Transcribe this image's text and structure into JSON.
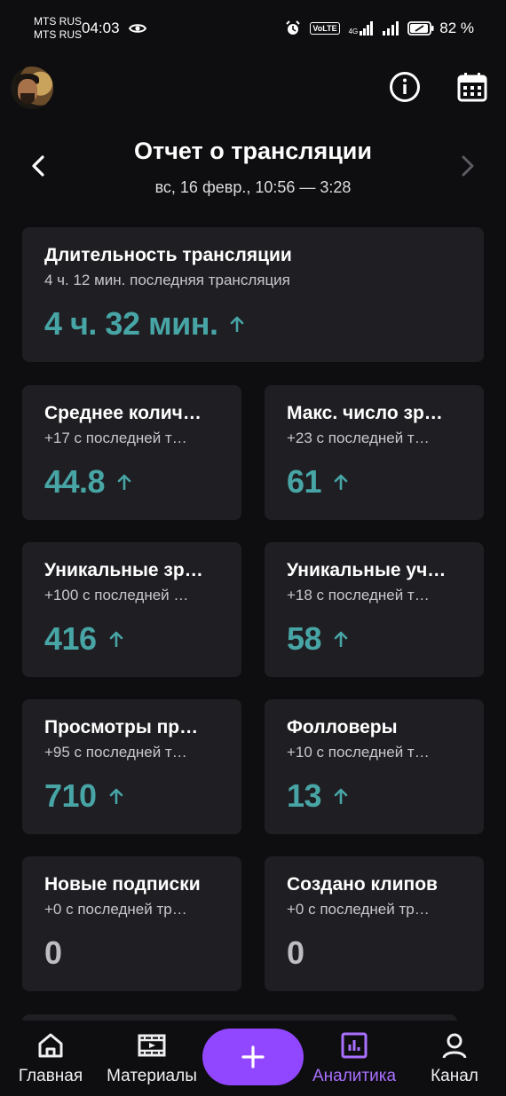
{
  "status_bar": {
    "carrier1": "MTS RUS",
    "carrier2": "MTS RUS",
    "time": "04:03",
    "volte": "VoLTE",
    "network": "4G",
    "battery": "82 %"
  },
  "header": {
    "title": "Отчет о трансляции",
    "subtitle": "вс, 16 февр., 10:56 — 3:28"
  },
  "duration_card": {
    "title": "Длительность трансляции",
    "sub": "4 ч. 12 мин. последняя трансляция",
    "value": "4 ч. 32 мин."
  },
  "stats": [
    {
      "title": "Среднее колич…",
      "sub": "+17 с последней т…",
      "value": "44.8",
      "trend": "up"
    },
    {
      "title": "Макс. число зр…",
      "sub": "+23 с последней т…",
      "value": "61",
      "trend": "up"
    },
    {
      "title": "Уникальные зр…",
      "sub": "+100 с последней …",
      "value": "416",
      "trend": "up"
    },
    {
      "title": "Уникальные уч…",
      "sub": "+18 с последней т…",
      "value": "58",
      "trend": "up"
    },
    {
      "title": "Просмотры пр…",
      "sub": "+95 с последней т…",
      "value": "710",
      "trend": "up"
    },
    {
      "title": "Фолловеры",
      "sub": "+10 с последней т…",
      "value": "13",
      "trend": "up"
    },
    {
      "title": "Новые подписки",
      "sub": "+0 с последней тр…",
      "value": "0",
      "trend": "none"
    },
    {
      "title": "Создано клипов",
      "sub": "+0 с последней тр…",
      "value": "0",
      "trend": "none"
    }
  ],
  "bottom_nav": {
    "home": "Главная",
    "content": "Материалы",
    "analytics": "Аналитика",
    "channel": "Канал"
  },
  "colors": {
    "accent_purple": "#9147ff",
    "active_tab": "#a970ff",
    "positive_value": "#48a5a6",
    "card_bg": "#1f1f23",
    "page_bg": "#0e0e10"
  }
}
